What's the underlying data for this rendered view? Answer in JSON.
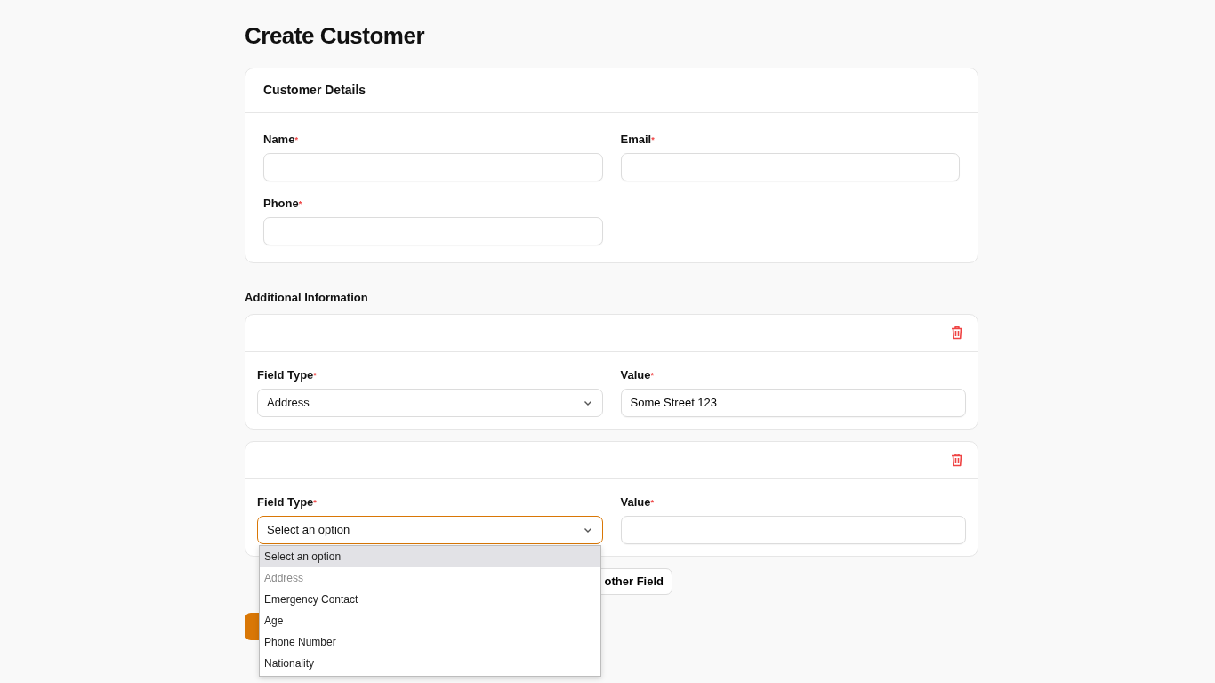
{
  "page_title": "Create Customer",
  "details_card": {
    "title": "Customer Details",
    "fields": [
      {
        "label": "Name",
        "required_mark": "*"
      },
      {
        "label": "Email",
        "required_mark": "*"
      },
      {
        "label": "Phone",
        "required_mark": "*"
      }
    ]
  },
  "additional_section": {
    "title": "Additional Information",
    "entries": [
      {
        "field_type": {
          "label": "Field Type",
          "required_mark": "*",
          "value": "Address",
          "focused": false
        },
        "value": {
          "label": "Value",
          "required_mark": "*",
          "value": "Some Street 123"
        }
      },
      {
        "field_type": {
          "label": "Field Type",
          "required_mark": "*",
          "value": "Select an option",
          "focused": true,
          "options": [
            {
              "label": "Select an option",
              "selected": true,
              "disabled": false
            },
            {
              "label": "Address",
              "selected": false,
              "disabled": true
            },
            {
              "label": "Emergency Contact",
              "selected": false,
              "disabled": false
            },
            {
              "label": "Age",
              "selected": false,
              "disabled": false
            },
            {
              "label": "Phone Number",
              "selected": false,
              "disabled": false
            },
            {
              "label": "Nationality",
              "selected": false,
              "disabled": false
            }
          ]
        },
        "value": {
          "label": "Value",
          "required_mark": "*"
        }
      }
    ]
  },
  "actions": [
    {
      "kind": "add_field",
      "label": "other Field"
    },
    {
      "kind": "submit"
    }
  ]
}
